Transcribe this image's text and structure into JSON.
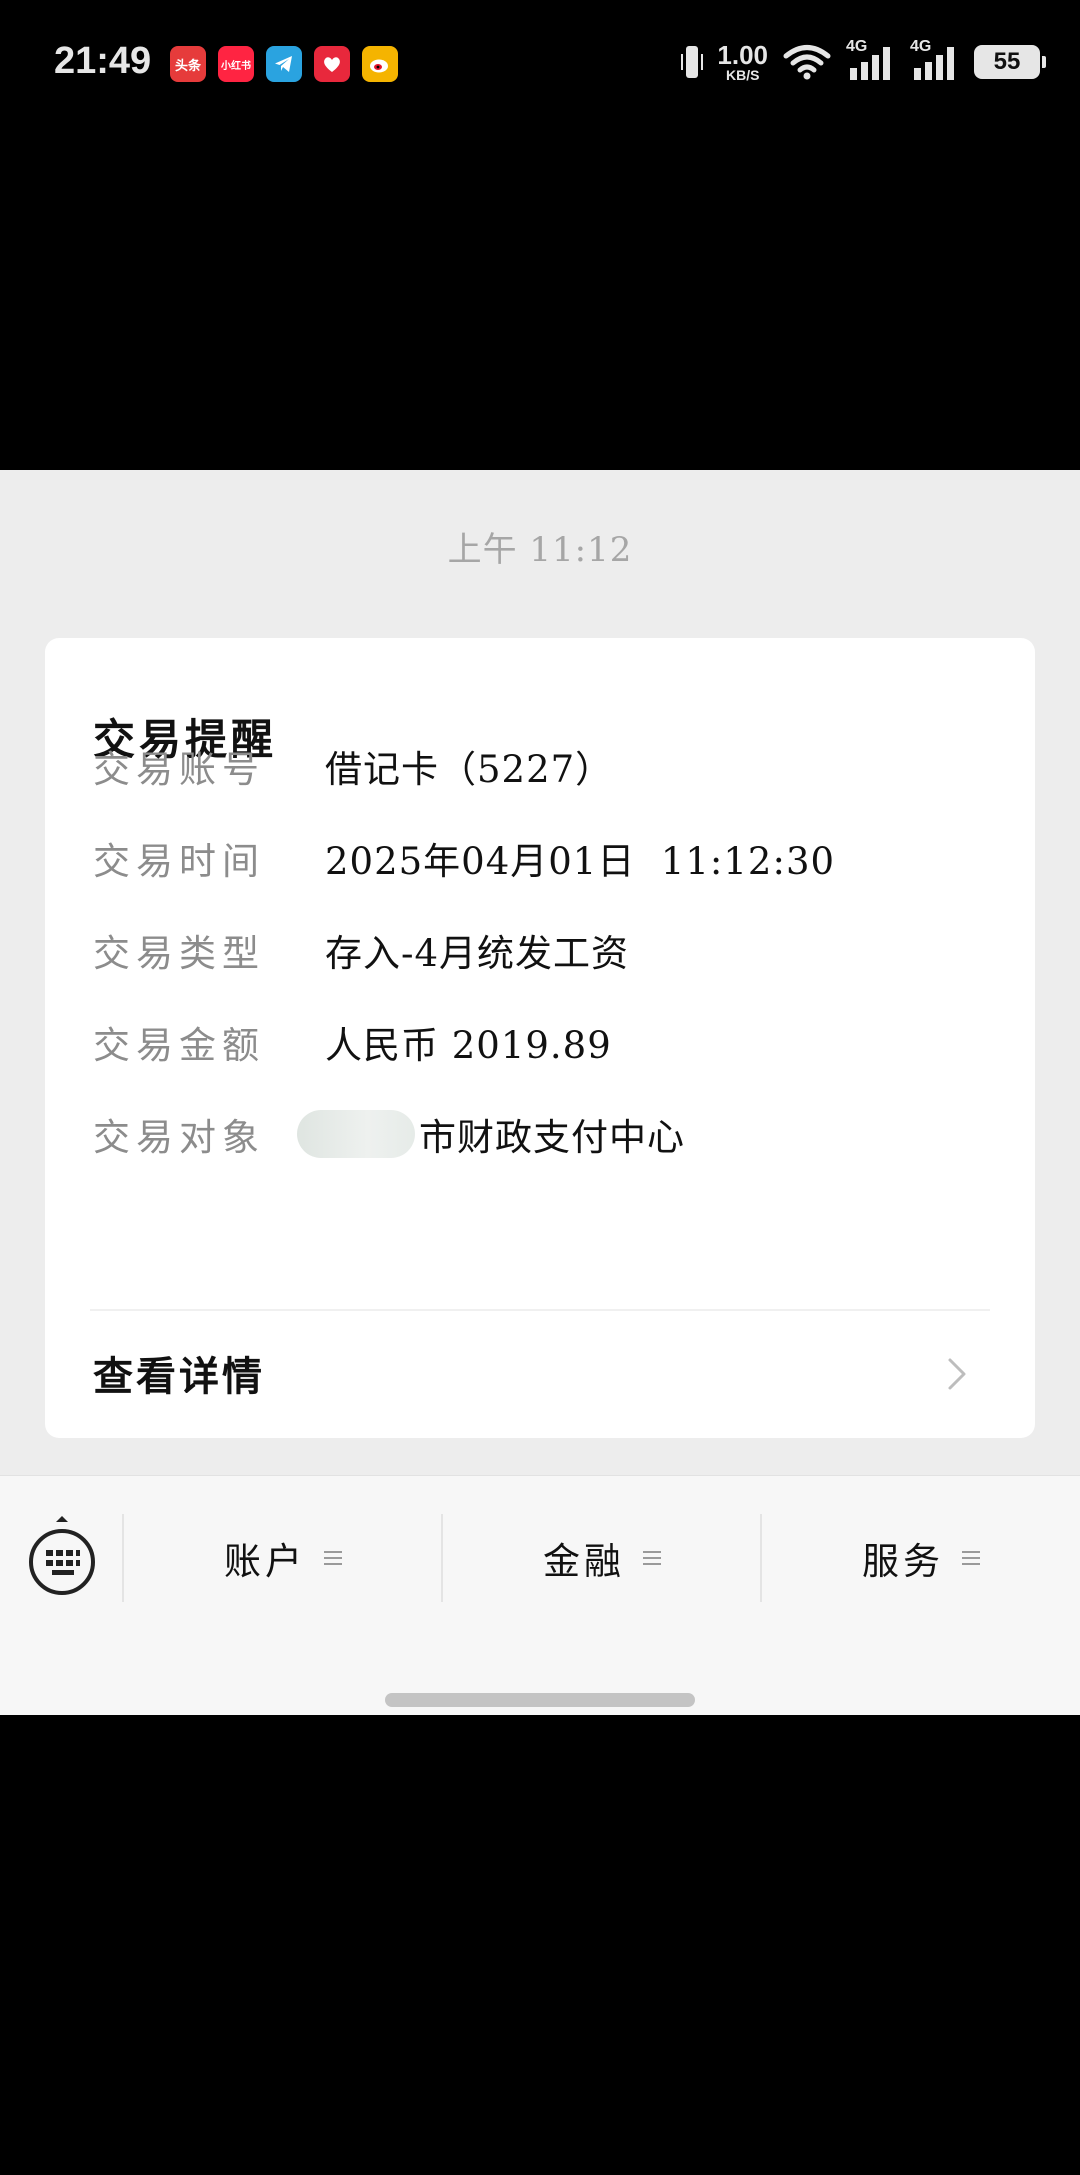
{
  "status_bar": {
    "time": "21:49",
    "apps": [
      {
        "name": "toutiao",
        "label": "头条",
        "color": "#e63b3b"
      },
      {
        "name": "xiaohongshu",
        "label": "小红书",
        "color": "#ff2442"
      },
      {
        "name": "telegram",
        "label": "",
        "color": "#2aa3e0"
      },
      {
        "name": "heart-app",
        "label": "",
        "color": "#e8283c"
      },
      {
        "name": "weibo",
        "label": "",
        "color": "#f5b400"
      }
    ],
    "speed_value": "1.00",
    "speed_unit": "KB/S",
    "network_1": "4G",
    "network_2": "4G",
    "battery": "55"
  },
  "message": {
    "time": "上午 11:12"
  },
  "card": {
    "title": "交易提醒",
    "rows": [
      {
        "label": "交易账号",
        "value": "借记卡（5227）"
      },
      {
        "label": "交易时间",
        "value": "2025年04月01日  11:12:30"
      },
      {
        "label": "交易类型",
        "value": "存入-4月统发工资"
      },
      {
        "label": "交易金额",
        "value": "人民币 2019.89"
      },
      {
        "label": "交易对象",
        "value": "市财政支付中心"
      }
    ],
    "detail_label": "查看详情"
  },
  "bottom_nav": {
    "items": [
      {
        "label": "账户"
      },
      {
        "label": "金融"
      },
      {
        "label": "服务"
      }
    ]
  }
}
